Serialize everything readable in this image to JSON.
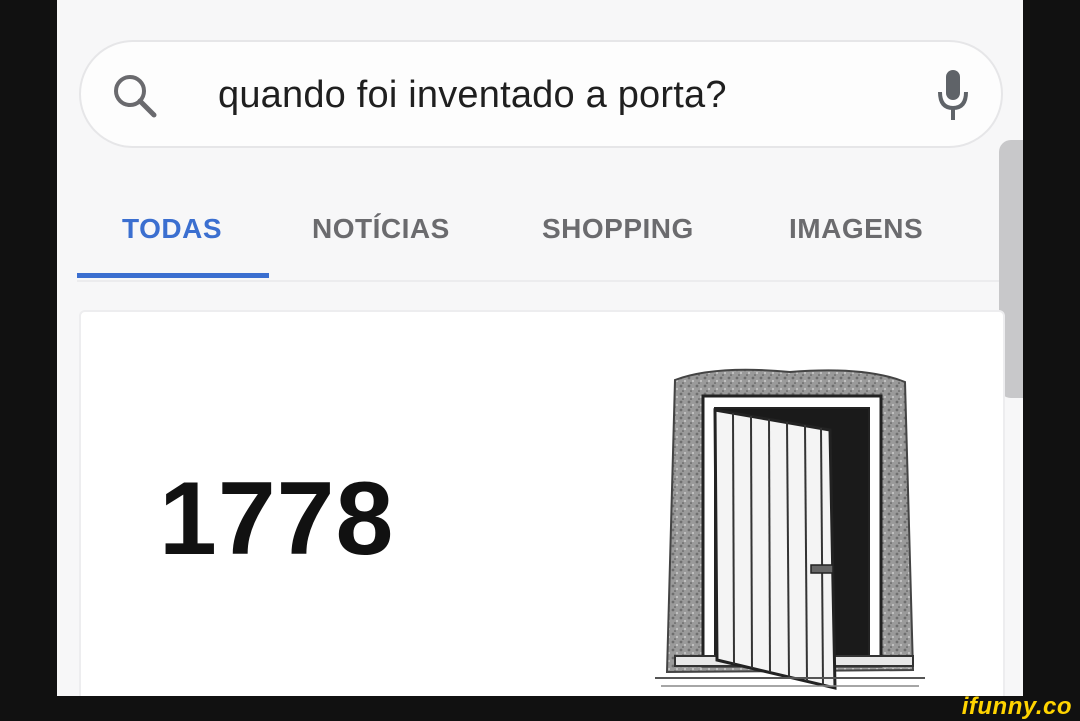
{
  "search": {
    "query": "quando foi inventado a porta?"
  },
  "tabs": [
    {
      "label": "TODAS",
      "active": true
    },
    {
      "label": "NOTÍCIAS",
      "active": false
    },
    {
      "label": "SHOPPING",
      "active": false
    },
    {
      "label": "IMAGENS",
      "active": false
    }
  ],
  "result": {
    "answer": "1778",
    "image_icon": "door-illustration"
  },
  "icons": {
    "search": "search-icon",
    "mic": "microphone-icon"
  },
  "watermark": "ifunny.co",
  "colors": {
    "accent": "#3b6fd0",
    "watermark": "#ffd400"
  }
}
